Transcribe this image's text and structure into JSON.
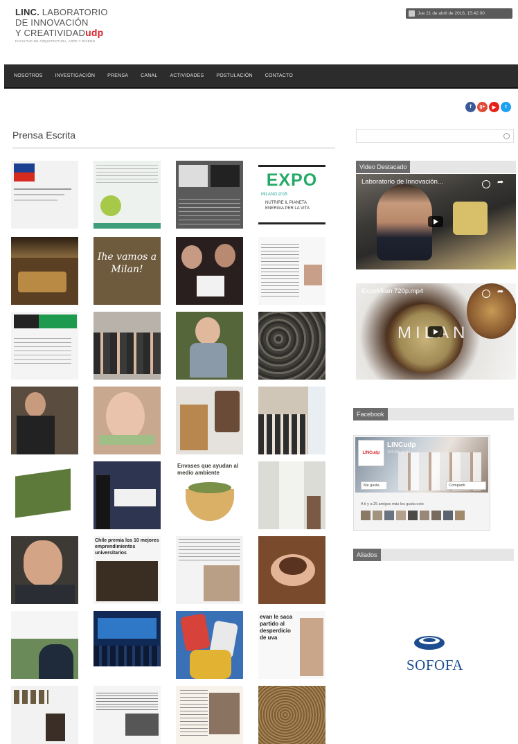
{
  "header": {
    "logo_line1_bold": "LINC.",
    "logo_line1_rest": " LABORATORIO",
    "logo_line2": "DE INNOVACIÓN",
    "logo_line3": "Y CREATIVIDAD",
    "logo_brand": "udp",
    "logo_subtitle": "FACULTAD DE ARQUITECTURA, ARTE Y DISEÑO",
    "date_text": "Jue 21 de abril de 2016, 15:42:00"
  },
  "nav": {
    "items": [
      "NOSOTROS",
      "INVESTIGACIÓN",
      "PRENSA",
      "CANAL",
      "ACTIVIDADES",
      "POSTULACIÓN",
      "CONTACTO"
    ]
  },
  "social": [
    {
      "name": "facebook",
      "glyph": "f",
      "color": "#3b5998"
    },
    {
      "name": "google-plus",
      "glyph": "g+",
      "color": "#dd4b39"
    },
    {
      "name": "youtube",
      "glyph": "▶",
      "color": "#e62117"
    },
    {
      "name": "twitter",
      "glyph": "t",
      "color": "#1da1f2"
    }
  ],
  "main": {
    "section_title": "Prensa Escrita",
    "tile_texts": {
      "expo": "EXPO",
      "expo_sub1": "MILANO 2015",
      "expo_sub2": "NUTRIRE IL PIANETA",
      "expo_sub3": "ENERGIA PER LA VITA",
      "milan": "Ihe vamos a Milan!",
      "envases": "Envases que ayudan al medio ambiente",
      "chile": "Chile premia los 10 mejores emprendimientos universitarios",
      "evan": "evan le saca partido al desperdicio de uva"
    },
    "tiles": [
      {
        "name": "tile-gobierno-chile",
        "bg": "#f2f2f2"
      },
      {
        "name": "tile-document-green",
        "bg": "#eef2ee"
      },
      {
        "name": "tile-presentation",
        "bg": "#5a5a5a"
      },
      {
        "name": "tile-expo-milano",
        "bg": "#ffffff"
      },
      {
        "name": "tile-exhibit-room",
        "bg": "#5b3f22"
      },
      {
        "name": "tile-nos-vamos-milan",
        "bg": "#6e5a3c"
      },
      {
        "name": "tile-award-women",
        "bg": "#2a1f1f"
      },
      {
        "name": "tile-news-article",
        "bg": "#f7f7f7"
      },
      {
        "name": "tile-website-screenshot",
        "bg": "#f4f4f4"
      },
      {
        "name": "tile-group-photo",
        "bg": "#b9b2aa"
      },
      {
        "name": "tile-woman-plants",
        "bg": "#55663a"
      },
      {
        "name": "tile-debris",
        "bg": "#4c4a44"
      },
      {
        "name": "tile-man-portrait",
        "bg": "#5a4c3e"
      },
      {
        "name": "tile-woman-smiling",
        "bg": "#c9a890"
      },
      {
        "name": "tile-material-samples",
        "bg": "#e5e2dd"
      },
      {
        "name": "tile-team-office",
        "bg": "#cfc6b8"
      },
      {
        "name": "tile-green-model",
        "bg": "#ffffff"
      },
      {
        "name": "tile-check-ceremony",
        "bg": "#2d3550"
      },
      {
        "name": "tile-envases",
        "bg": "#ffffff"
      },
      {
        "name": "tile-gallery",
        "bg": "#dcdcd6"
      },
      {
        "name": "tile-man-close",
        "bg": "#3d3a36"
      },
      {
        "name": "tile-chile-premia",
        "bg": "#f5f5f5"
      },
      {
        "name": "tile-newspaper",
        "bg": "#f3f3f3"
      },
      {
        "name": "tile-hands-soil",
        "bg": "#7a4a2c"
      },
      {
        "name": "tile-woman-presentation",
        "bg": "#6b8a5a"
      },
      {
        "name": "tile-stage-event",
        "bg": "#102a55"
      },
      {
        "name": "tile-colorful-bags",
        "bg": "#3a70b5"
      },
      {
        "name": "tile-evan-uva",
        "bg": "#f8f8f8"
      },
      {
        "name": "tile-products",
        "bg": "#f2f2f2"
      },
      {
        "name": "tile-news-columns",
        "bg": "#f4f4f4"
      },
      {
        "name": "tile-magazine",
        "bg": "#f7f2ea"
      },
      {
        "name": "tile-grain",
        "bg": "#8b6f45"
      }
    ]
  },
  "sidebar": {
    "video_title": "Video Destacado",
    "video1_caption": "Laboratorio de Innovación...",
    "video2_caption": "ExpoMilan 720p.mp4",
    "video2_overlay": "MILAN",
    "facebook_title": "Facebook",
    "fb_page_name": "LINCudp",
    "fb_page_likes": "413 Me gusta",
    "fb_avatar_text": "LINCudp",
    "fb_like_btn": "Me gusta",
    "fb_share_btn": "Compartir",
    "fb_friends_text": "A ti y a 25 amigos más les gusta esto",
    "aliados_title": "Aliados",
    "sofofa": "SOFOFA"
  }
}
